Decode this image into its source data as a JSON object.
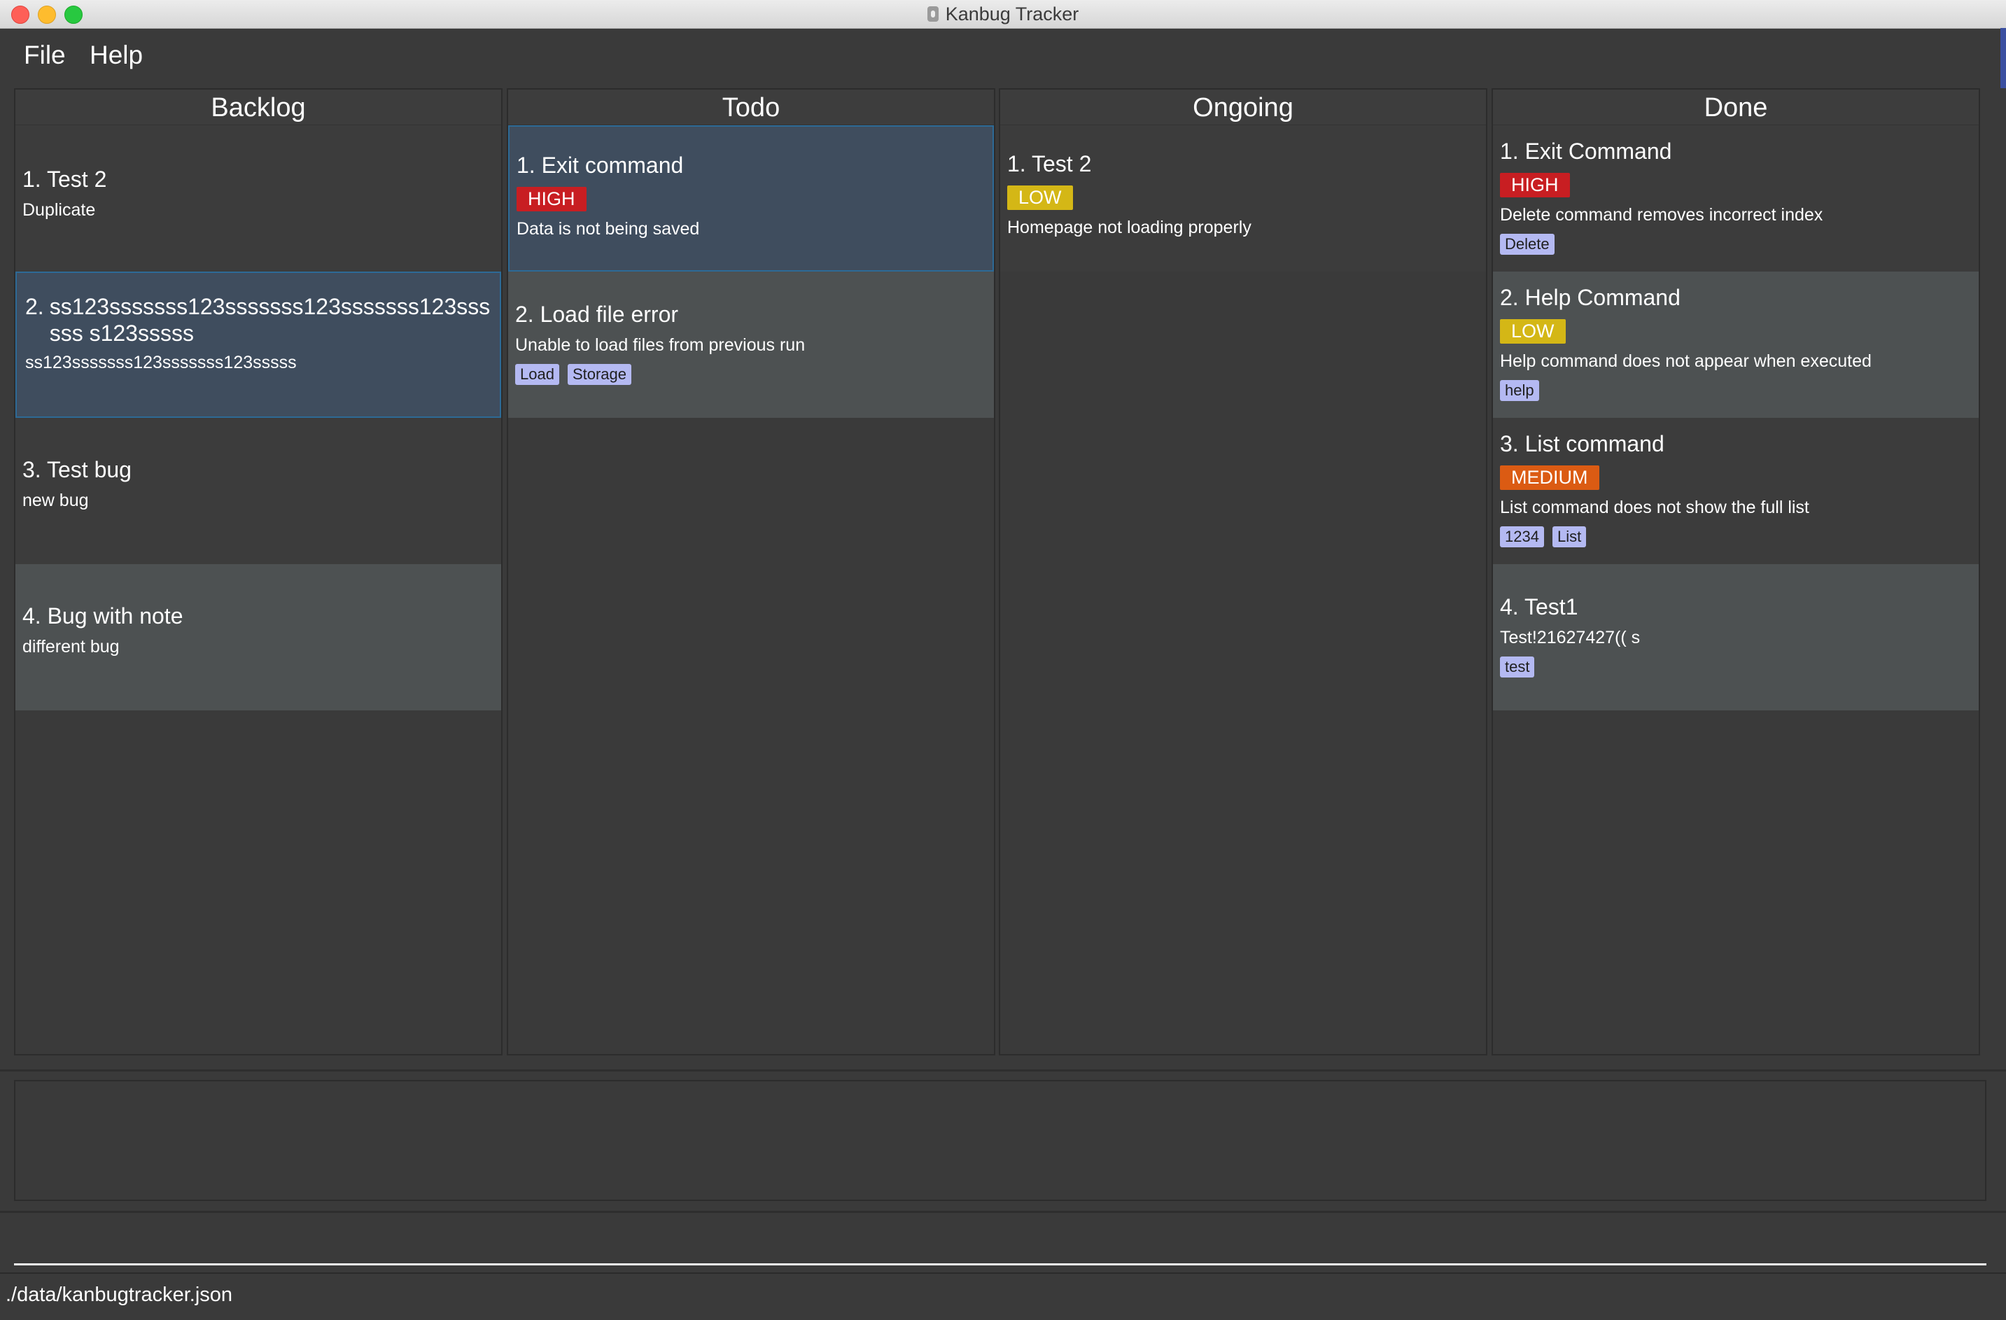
{
  "window": {
    "title": "Kanbug Tracker",
    "icon": "bug-icon"
  },
  "menu": {
    "file": "File",
    "help": "Help"
  },
  "columns": [
    {
      "header": "Backlog",
      "cards": [
        {
          "title": "1. Test  2",
          "description": "Duplicate"
        },
        {
          "index": "2.",
          "title": "ss123sssssss123sssssss123sssssss123ssssss s123sssss",
          "description": "ss123sssssss123sssssss123sssss",
          "selected": true
        },
        {
          "title": "3. Test bug",
          "description": "new bug"
        },
        {
          "title": "4. Bug with note",
          "description": "different bug"
        }
      ]
    },
    {
      "header": "Todo",
      "cards": [
        {
          "title": "1. Exit command",
          "priority": "HIGH",
          "description": "Data is not being saved",
          "selected": true
        },
        {
          "title": "2. Load file error",
          "description": "Unable to load files from previous run",
          "tags": [
            "Load",
            "Storage"
          ]
        }
      ]
    },
    {
      "header": "Ongoing",
      "cards": [
        {
          "title": "1. Test 2",
          "priority": "LOW",
          "description": "Homepage not loading properly"
        }
      ]
    },
    {
      "header": "Done",
      "cards": [
        {
          "title": "1. Exit Command",
          "priority": "HIGH",
          "description": "Delete command removes incorrect index",
          "tags": [
            "Delete"
          ]
        },
        {
          "title": "2. Help Command",
          "priority": "LOW",
          "description": "Help command does not appear when executed",
          "tags": [
            "help"
          ]
        },
        {
          "title": "3. List command",
          "priority": "MEDIUM",
          "description": "List command does not show the full list",
          "tags": [
            "1234",
            "List"
          ]
        },
        {
          "title": "4. Test1",
          "description": "Test!21627427(( s",
          "tags": [
            "test"
          ]
        }
      ]
    }
  ],
  "result_display": "",
  "command_box": {
    "value": ""
  },
  "status": {
    "file_path": "./data/kanbugtracker.json"
  },
  "colors": {
    "background": "#3a3a3a",
    "card_dark": "#3c3c3c",
    "card_light": "#4d5152",
    "card_selected": "#3f4d5e",
    "selected_border": "#2d6a96",
    "priority_high": "#c81e22",
    "priority_low": "#d4b716",
    "priority_medium": "#db5b13",
    "tag": "#b4b9f2"
  }
}
